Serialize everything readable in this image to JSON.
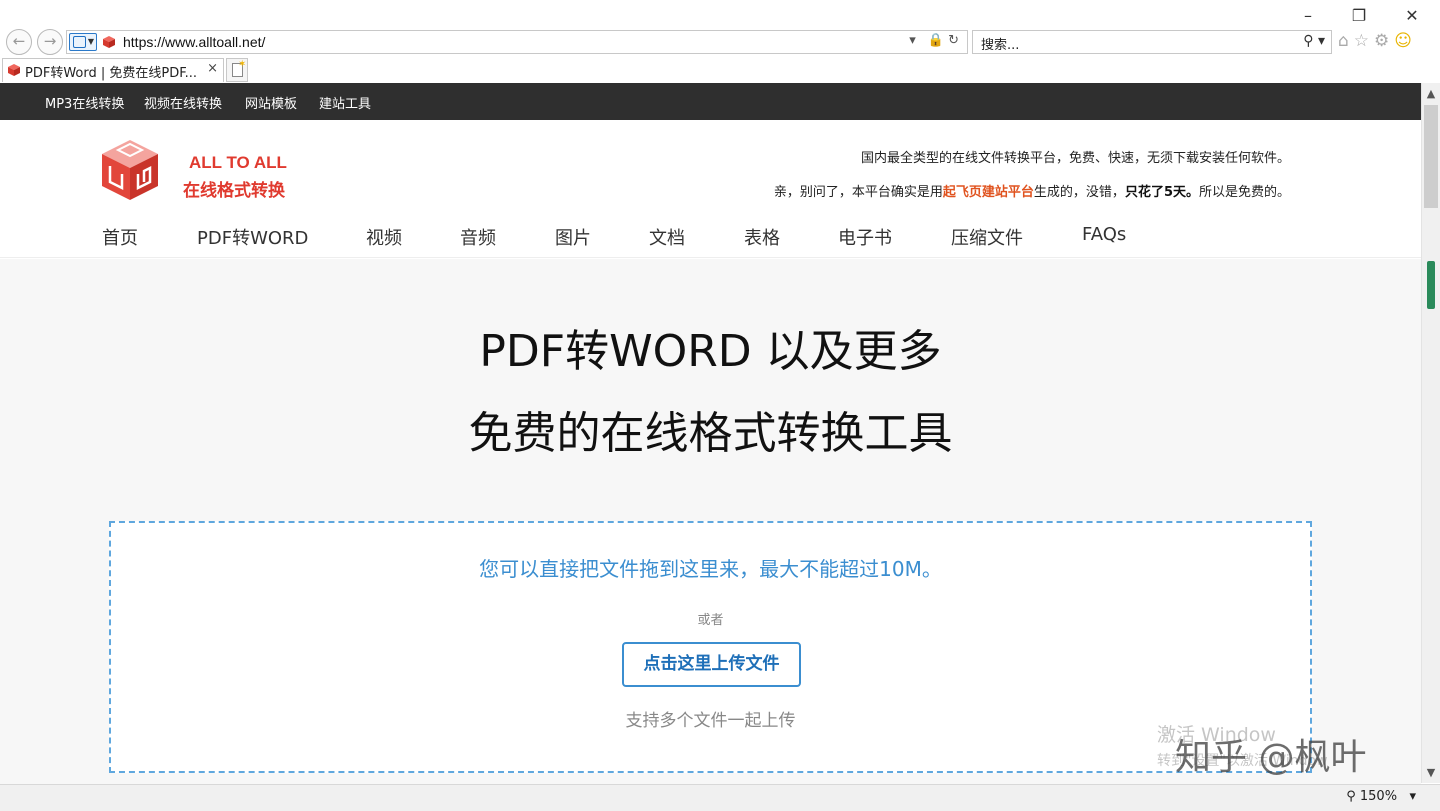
{
  "browser": {
    "url": "https://www.alltoall.net/",
    "search_placeholder": "搜索...",
    "tab_title": "PDF转Word | 免费在线PDF...",
    "tab_close": "×",
    "zoom": "150%",
    "window": {
      "minimize": "–",
      "restore": "❐",
      "close": "✕"
    }
  },
  "site": {
    "topbar_links": [
      "MP3在线转换",
      "视频在线转换",
      "网站模板",
      "建站工具"
    ],
    "logo": {
      "en": "ALL TO ALL",
      "cn": "在线格式转换"
    },
    "tagline1": "国内最全类型的在线文件转换平台，免费、快速，无须下载安装任何软件。",
    "tagline2": {
      "prefix": "亲，别问了，本平台确实是用",
      "highlight": "起飞页建站平台",
      "middle": "生成的，没错，",
      "bold": "只花了5天。",
      "suffix": "所以是免费的。"
    },
    "nav": [
      "首页",
      "PDF转WORD",
      "视频",
      "音频",
      "图片",
      "文档",
      "表格",
      "电子书",
      "压缩文件",
      "FAQs"
    ],
    "hero": {
      "line1": "PDF转WORD 以及更多",
      "line2": "免费的在线格式转换工具"
    },
    "upload": {
      "drop_text": "您可以直接把文件拖到这里来，最大不能超过10M。",
      "or": "或者",
      "button": "点击这里上传文件",
      "multi": "支持多个文件一起上传"
    }
  },
  "watermark": {
    "win_line1": "激活 Window",
    "win_line2": "转到\"设置\"以激活 Window",
    "zh": "知乎 @枫叶"
  },
  "colors": {
    "brand": "#e03a2f",
    "accent": "#3b8ed0",
    "topbar": "#2f2f2f",
    "highlight": "#e0531f"
  }
}
